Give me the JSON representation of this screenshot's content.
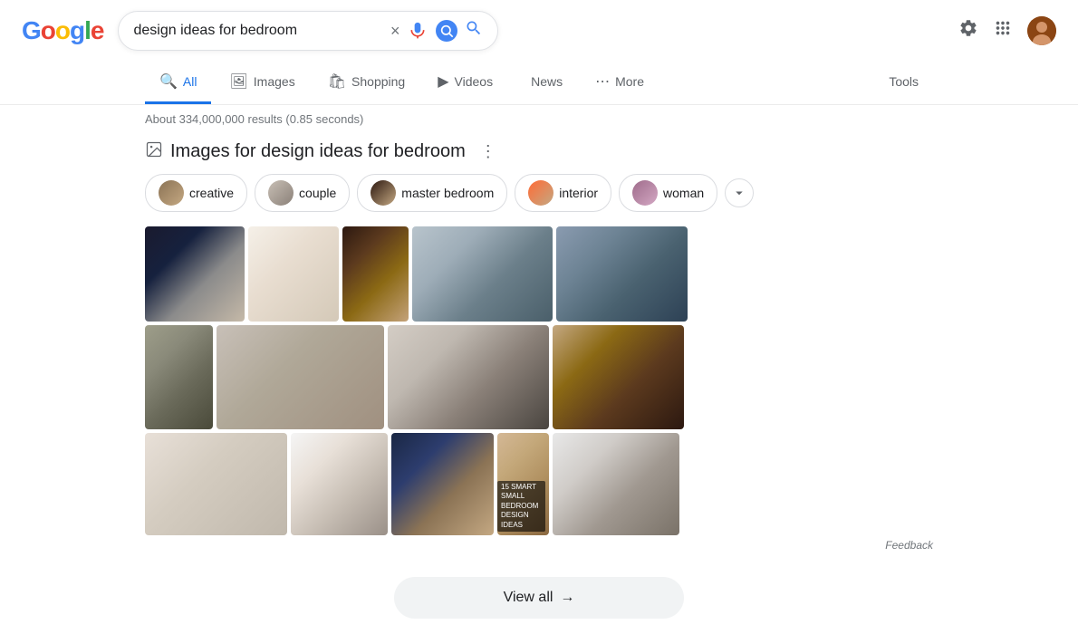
{
  "header": {
    "logo": "Google",
    "search_query": "design ideas for bedroom",
    "clear_label": "×",
    "search_button_label": "🔍"
  },
  "nav": {
    "tabs": [
      {
        "id": "all",
        "label": "All",
        "icon": "🔍",
        "active": true
      },
      {
        "id": "images",
        "label": "Images",
        "icon": "🖼️",
        "active": false
      },
      {
        "id": "shopping",
        "label": "Shopping",
        "icon": "🛍️",
        "active": false
      },
      {
        "id": "videos",
        "label": "Videos",
        "icon": "▶️",
        "active": false
      },
      {
        "id": "news",
        "label": "News",
        "icon": "📰",
        "active": false
      },
      {
        "id": "more",
        "label": "More",
        "icon": "⋯",
        "active": false
      },
      {
        "id": "tools",
        "label": "Tools",
        "icon": "",
        "active": false
      }
    ]
  },
  "results": {
    "count_text": "About 334,000,000 results (0.85 seconds)"
  },
  "images_section": {
    "title": "Images for design ideas for bedroom",
    "filter_chips": [
      {
        "id": "creative",
        "label": "creative",
        "thumb_class": "chip-creative"
      },
      {
        "id": "couple",
        "label": "couple",
        "thumb_class": "chip-couple"
      },
      {
        "id": "master",
        "label": "master bedroom",
        "thumb_class": "chip-master"
      },
      {
        "id": "interior",
        "label": "interior",
        "thumb_class": "chip-interior"
      },
      {
        "id": "woman",
        "label": "woman",
        "thumb_class": "chip-woman"
      }
    ]
  },
  "view_all": {
    "label": "View all",
    "arrow": "→"
  },
  "feedback": {
    "label": "Feedback"
  }
}
